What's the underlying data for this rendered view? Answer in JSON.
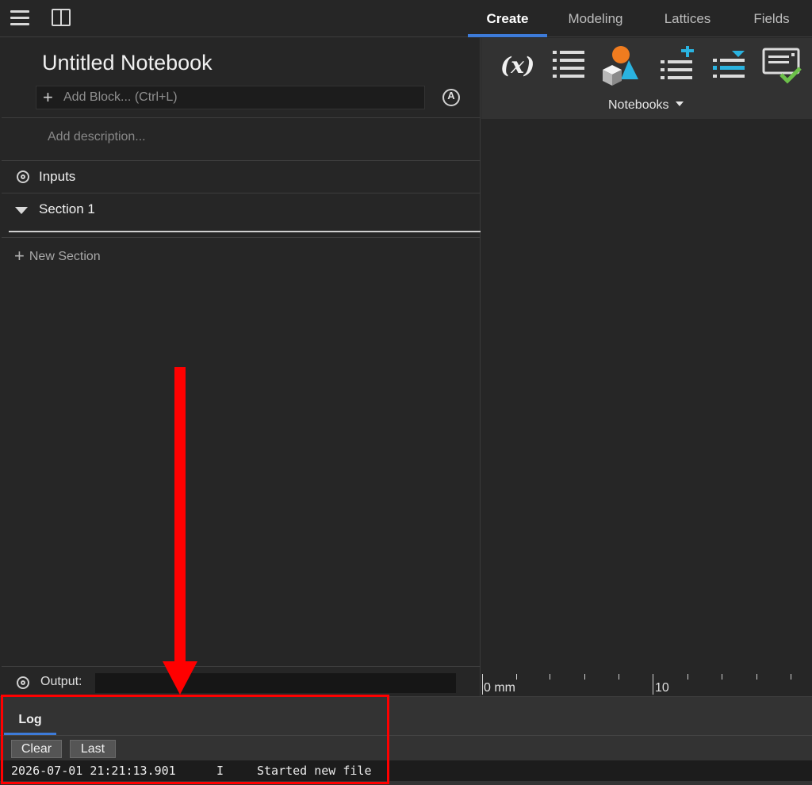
{
  "topbar": {
    "menu_icon": "hamburger-menu-icon",
    "panel_icon": "split-panel-icon",
    "tabs": [
      {
        "label": "Create",
        "active": true
      },
      {
        "label": "Modeling",
        "active": false
      },
      {
        "label": "Lattices",
        "active": false
      },
      {
        "label": "Fields",
        "active": false
      }
    ],
    "accent_color": "#3d7bd9"
  },
  "notebook": {
    "title": "Untitled Notebook",
    "add_block_placeholder": "Add Block... (Ctrl+L)",
    "description_placeholder": "Add description...",
    "inputs_label": "Inputs",
    "section_label": "Section 1",
    "new_section_label": "New Section",
    "output_label": "Output:",
    "output_value": ""
  },
  "toolbar": {
    "tools": [
      "variable-icon",
      "list-icon",
      "shapes-icon",
      "add-list-icon",
      "insert-list-icon",
      "check-panel-icon"
    ],
    "variable_text": "(x)",
    "dropdown_label": "Notebooks"
  },
  "ruler": {
    "labels": [
      "0 mm",
      "10"
    ]
  },
  "log": {
    "tab_label": "Log",
    "buttons": {
      "clear": "Clear",
      "last": "Last"
    },
    "entries": [
      {
        "timestamp": "2026-07-01 21:21:13.901",
        "level": "I",
        "message": "Started new file"
      }
    ]
  },
  "annotation": {
    "color": "#ff0000"
  }
}
